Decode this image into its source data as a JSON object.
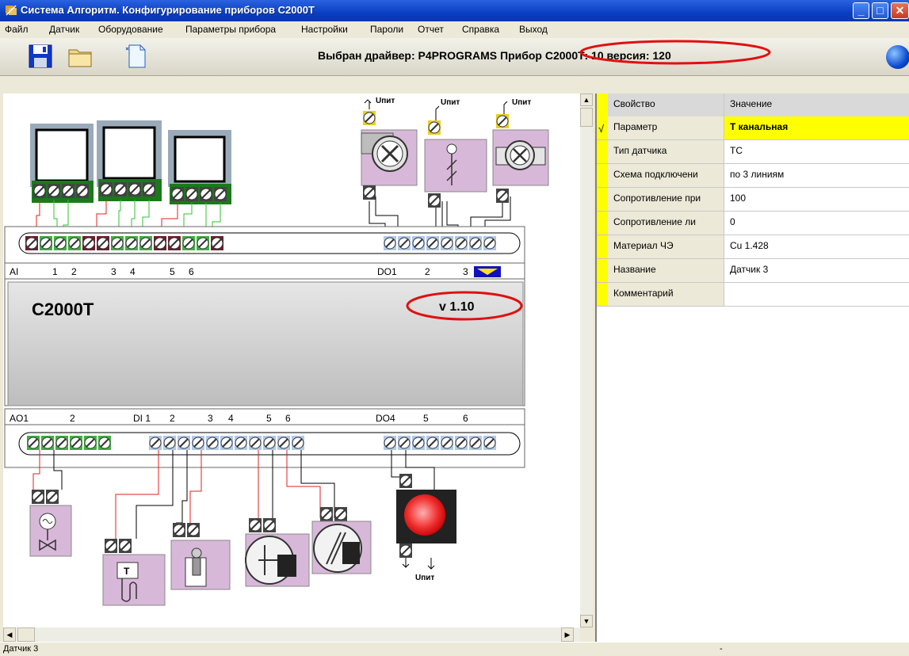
{
  "window": {
    "title": "Система Алгоритм. Конфигурирование приборов С2000Т"
  },
  "menu": [
    "Файл",
    "Датчик",
    "Оборудование",
    "Параметры прибора",
    "Настройки",
    "Пароли",
    "Отчет",
    "Справка",
    "Выход"
  ],
  "toolbar": {
    "driver_text": "Выбран драйвер: P4PROGRAMS Прибор С2000Т: 10 версия: 120"
  },
  "device": {
    "name": "С2000Т",
    "version": "v 1.10",
    "top_labels": {
      "ai": "AI",
      "a1": "1",
      "a2": "2",
      "a3": "3",
      "a4": "4",
      "a5": "5",
      "a6": "6",
      "do1": "DO1",
      "d2": "2",
      "d3": "3"
    },
    "bottom_labels": {
      "ao1": "AO1",
      "b2": "2",
      "di1": "DI 1",
      "b3": "2",
      "b4": "3",
      "b5": "4",
      "b6": "5",
      "b7": "6",
      "do4": "DO4",
      "b8": "5",
      "b9": "6"
    },
    "power_label": "Uпит",
    "sensor_t_label": "T"
  },
  "properties": {
    "header": {
      "prop": "Свойство",
      "val": "Значение"
    },
    "rows": [
      {
        "prop": "Параметр",
        "val": "Т канальная"
      },
      {
        "prop": "Тип датчика",
        "val": "ТС"
      },
      {
        "prop": "Схема подключени",
        "val": "по 3 линиям"
      },
      {
        "prop": "Сопротивление при",
        "val": "100"
      },
      {
        "prop": "Сопротивление ли",
        "val": "0"
      },
      {
        "prop": "Материал ЧЭ",
        "val": "Cu 1.428"
      },
      {
        "prop": "Название",
        "val": "Датчик 3"
      },
      {
        "prop": "Комментарий",
        "val": ""
      }
    ]
  },
  "status": {
    "left": "Датчик 3",
    "right": "-"
  },
  "colors": {
    "accent_red": "#e01010",
    "pink": "#d8b8d8",
    "terminal_blue": "#a8c8f0",
    "terminal_green": "#30b030",
    "highlight": "#ffff00"
  }
}
